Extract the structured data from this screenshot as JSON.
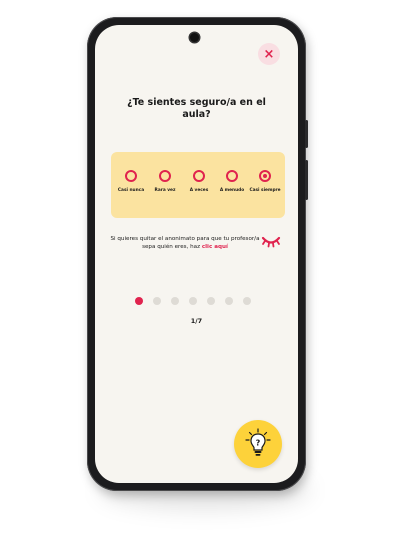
{
  "header": {
    "close_icon": "×"
  },
  "question": {
    "text": "¿Te sientes seguro/a en el aula?"
  },
  "scale": {
    "options": [
      {
        "label": "Casi nunca"
      },
      {
        "label": "Rara vez"
      },
      {
        "label": "A veces"
      },
      {
        "label": "A menudo"
      },
      {
        "label": "Casi siempre"
      }
    ],
    "selected_index": 4
  },
  "anonymity": {
    "text": "Si quieres quitar el anonimato para que tu profesor/a sepa quién eres, haz",
    "link_label": "clic aquí",
    "icon": "closed-eye-icon"
  },
  "progress": {
    "current": 1,
    "total": 7,
    "label": "1/7"
  },
  "help_button": {
    "icon": "lightbulb-question-icon",
    "glyph": "?"
  },
  "colors": {
    "accent": "#e0234e",
    "card": "#fbe3a0",
    "fab": "#fdd23a",
    "screen_bg": "#f7f5f0"
  }
}
